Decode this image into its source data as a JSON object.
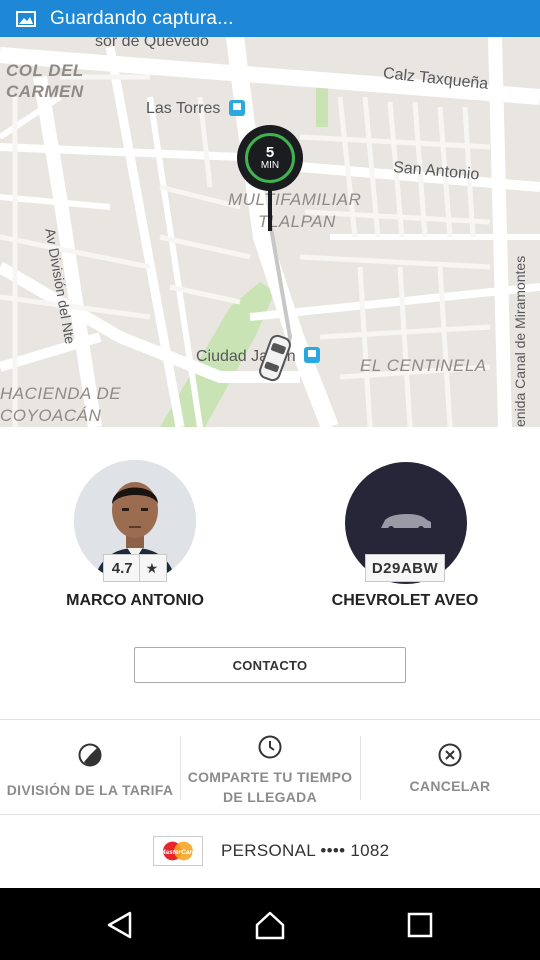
{
  "status_bar": {
    "text": "Guardando captura..."
  },
  "map": {
    "labels": {
      "quevedo": "sor de Quevedo",
      "col_del": "COL DEL",
      "carmen": "CARMEN",
      "las_torres": "Las Torres",
      "taxquena": "Calz Taxqueña",
      "san_antonio": "San Antonio",
      "multifamiliar": "MULTIFAMILIAR",
      "tlalpan": "TLALPAN",
      "av_division": "Av División del Nte",
      "miramontes": "enida Canal de Miramontes",
      "ciudad_jardin": "Ciudad Jardín",
      "el_centinela": "EL CENTINELA",
      "hacienda": "HACIENDA DE",
      "coyoacan": "COYOACÁN"
    },
    "eta": {
      "value": "5",
      "unit": "MIN"
    },
    "colors": {
      "road": "#ffffff",
      "block": "#e9e6e1",
      "park": "#c9e3b5",
      "route": "#c7c7c7",
      "eta_ring": "#3fb34f"
    }
  },
  "driver": {
    "name": "MARCO ANTONIO",
    "rating": "4.7",
    "rating_icon": "star-icon"
  },
  "vehicle": {
    "model": "CHEVROLET AVEO",
    "plate": "D29ABW"
  },
  "contact_button": "CONTACTO",
  "actions": [
    {
      "line1": "DIVISIÓN DE LA TARIFA",
      "icon": "split-fare-icon"
    },
    {
      "line1": "COMPARTE TU TIEMPO",
      "line2": "DE LLEGADA",
      "icon": "clock-icon"
    },
    {
      "line1": "CANCELAR",
      "icon": "cancel-icon"
    }
  ],
  "payment": {
    "card_brand": "MasterCard",
    "text": "PERSONAL •••• 1082"
  },
  "nav": {
    "back": "back-icon",
    "home": "home-icon",
    "recents": "recents-icon"
  }
}
